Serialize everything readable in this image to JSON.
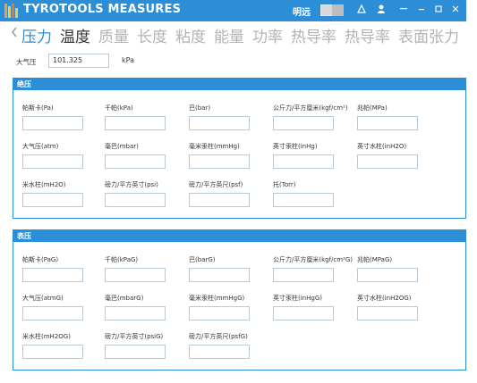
{
  "titlebar": {
    "title": "TYROTOOLS MEASURES",
    "user": "明远",
    "accent": "#2b8ed6"
  },
  "nav": {
    "items": [
      "压力",
      "温度",
      "质量",
      "长度",
      "粘度",
      "能量",
      "功率",
      "热导率",
      "热导率",
      "表面张力"
    ]
  },
  "main_input": {
    "label": "大气压",
    "value": "101.325",
    "unit": "kPa"
  },
  "absolute": {
    "title": "绝压",
    "fields": [
      "帕斯卡(Pa)",
      "千帕(kPa)",
      "巴(bar)",
      "公斤力/平方厘米(kgf/cm²)",
      "兆帕(MPa)",
      "大气压(atm)",
      "毫巴(mbar)",
      "毫米汞柱(mmHg)",
      "英寸汞柱(inHg)",
      "英寸水柱(inH2O)",
      "米水柱(mH2O)",
      "磅力/平方英寸(psi)",
      "磅力/平方英尺(psf)",
      "托(Torr)"
    ]
  },
  "gauge": {
    "title": "表压",
    "fields": [
      "帕斯卡(PaG)",
      "千帕(kPaG)",
      "巴(barG)",
      "公斤力/平方厘米(kgf/cm²G)",
      "兆帕(MPaG)",
      "大气压(atmG)",
      "毫巴(mbarG)",
      "毫米汞柱(mmHgG)",
      "英寸汞柱(inHgG)",
      "英寸水柱(inH2OG)",
      "米水柱(mH2OG)",
      "磅力/平方英寸(psiG)",
      "磅力/平方英尺(psfG)"
    ]
  }
}
